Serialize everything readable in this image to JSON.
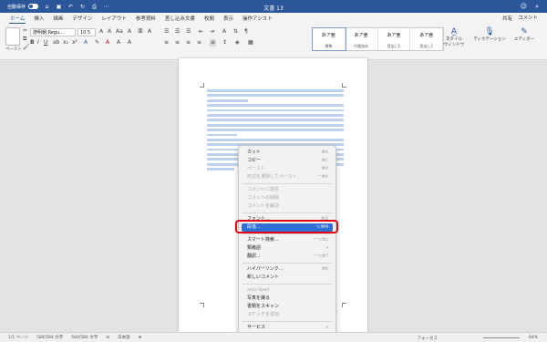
{
  "titlebar": {
    "autosave_label": "自動保存",
    "toggle_state": "オフ",
    "doc_title": "文書 13",
    "colors": {
      "titlebar_bg": "#2b579a"
    }
  },
  "tabs": [
    "ホーム",
    "挿入",
    "描画",
    "デザイン",
    "レイアウト",
    "参考資料",
    "差し込み文書",
    "校閲",
    "表示",
    "操作アシスト"
  ],
  "share": "共有",
  "comment": "コメント",
  "ribbon": {
    "paste_label": "ペースト",
    "font_name": "游明朝 Regu...",
    "font_size": "10.5",
    "styles": [
      {
        "preview": "あア亜",
        "name": "標準"
      },
      {
        "preview": "あア亜",
        "name": "行間詰め"
      },
      {
        "preview": "あア亜",
        "name": "見出し1"
      },
      {
        "preview": "あア亜",
        "name": "見出し2"
      }
    ],
    "style_pane": "スタイル\nウィンドウ",
    "dictation": "ディクテーション",
    "editor": "エディター"
  },
  "context_menu": {
    "items": [
      {
        "label": "カット",
        "shortcut": "⌘X",
        "enabled": true
      },
      {
        "label": "コピー",
        "shortcut": "⌘C",
        "enabled": true
      },
      {
        "label": "ペースト",
        "shortcut": "⌘V",
        "enabled": false
      },
      {
        "label": "形式を選択してペースト...",
        "shortcut": "^⌘V",
        "enabled": false
      },
      {
        "sep": true
      },
      {
        "label": "コメントに返信",
        "enabled": false
      },
      {
        "label": "コメントの削除",
        "enabled": false
      },
      {
        "label": "コメントを解決",
        "enabled": false
      },
      {
        "sep": true
      },
      {
        "label": "フォント...",
        "shortcut": "⌘D",
        "enabled": true
      },
      {
        "label": "段落...",
        "shortcut": "⌥⌘M",
        "enabled": true,
        "highlighted": true
      },
      {
        "sep": true
      },
      {
        "label": "スマート検索...",
        "shortcut": "^⌥⌘L",
        "enabled": true
      },
      {
        "label": "類義語",
        "submenu": true,
        "enabled": true
      },
      {
        "label": "翻訳...",
        "shortcut": "^⌥⌘T",
        "enabled": true
      },
      {
        "sep": true
      },
      {
        "label": "ハイパーリンク...",
        "shortcut": "⌘K",
        "enabled": true
      },
      {
        "label": "新しいコメント",
        "enabled": true
      },
      {
        "sep": true
      },
      {
        "label": "anju iipad",
        "enabled": false
      },
      {
        "label": "写真を撮る",
        "enabled": true
      },
      {
        "label": "書類をスキャン",
        "enabled": true
      },
      {
        "label": "スケッチを追加",
        "enabled": false
      },
      {
        "sep": true
      },
      {
        "label": "サービス",
        "submenu": true,
        "enabled": true
      }
    ]
  },
  "statusbar": {
    "page": "1/1 ページ",
    "chars": "584/584 文字",
    "chars2": "584/584 文字",
    "lang": "日本語",
    "focus": "フォーカス",
    "zoom": "84%"
  }
}
